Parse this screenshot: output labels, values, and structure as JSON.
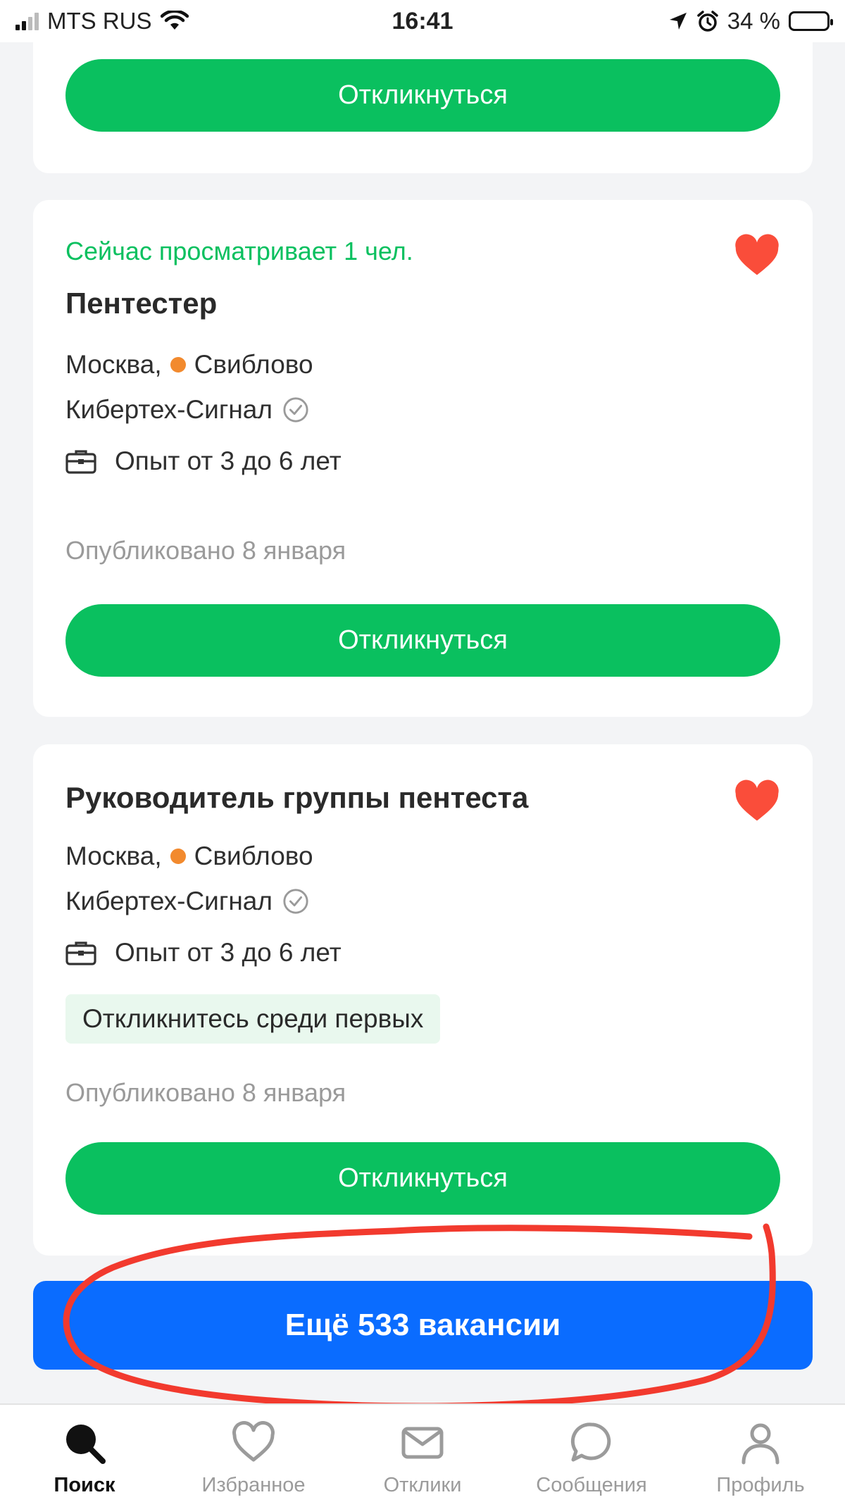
{
  "status_bar": {
    "carrier": "MTS RUS",
    "time": "16:41",
    "battery_percent": "34 %",
    "battery_level": 0.34
  },
  "cards": [
    {
      "respond_label": "Откликнуться"
    },
    {
      "viewing": "Сейчас просматривает 1 чел.",
      "title": "Пентестер",
      "city": "Москва,",
      "metro": "Свиблово",
      "company": "Кибертех-Сигнал",
      "experience": "Опыт от 3 до 6 лет",
      "published": "Опубликовано 8 января",
      "respond_label": "Откликнуться",
      "favorited": true
    },
    {
      "title": "Руководитель группы пентеста",
      "city": "Москва,",
      "metro": "Свиблово",
      "company": "Кибертех-Сигнал",
      "experience": "Опыт от 3 до 6 лет",
      "chip": "Откликнитесь среди первых",
      "published": "Опубликовано 8 января",
      "respond_label": "Откликнуться",
      "favorited": true
    }
  ],
  "more_button": "Ещё 533 вакансии",
  "tabs": [
    {
      "label": "Поиск",
      "icon": "search-icon",
      "active": true
    },
    {
      "label": "Избранное",
      "icon": "heart-outline-icon",
      "active": false
    },
    {
      "label": "Отклики",
      "icon": "envelope-icon",
      "active": false
    },
    {
      "label": "Сообщения",
      "icon": "chat-bubble-icon",
      "active": false
    },
    {
      "label": "Профиль",
      "icon": "person-icon",
      "active": false
    }
  ],
  "colors": {
    "primary_green": "#0ac05f",
    "primary_blue": "#0a6cff",
    "heart_red": "#fa4d3a",
    "metro_orange": "#f28a2e",
    "annotation_red": "#f23a2e"
  }
}
